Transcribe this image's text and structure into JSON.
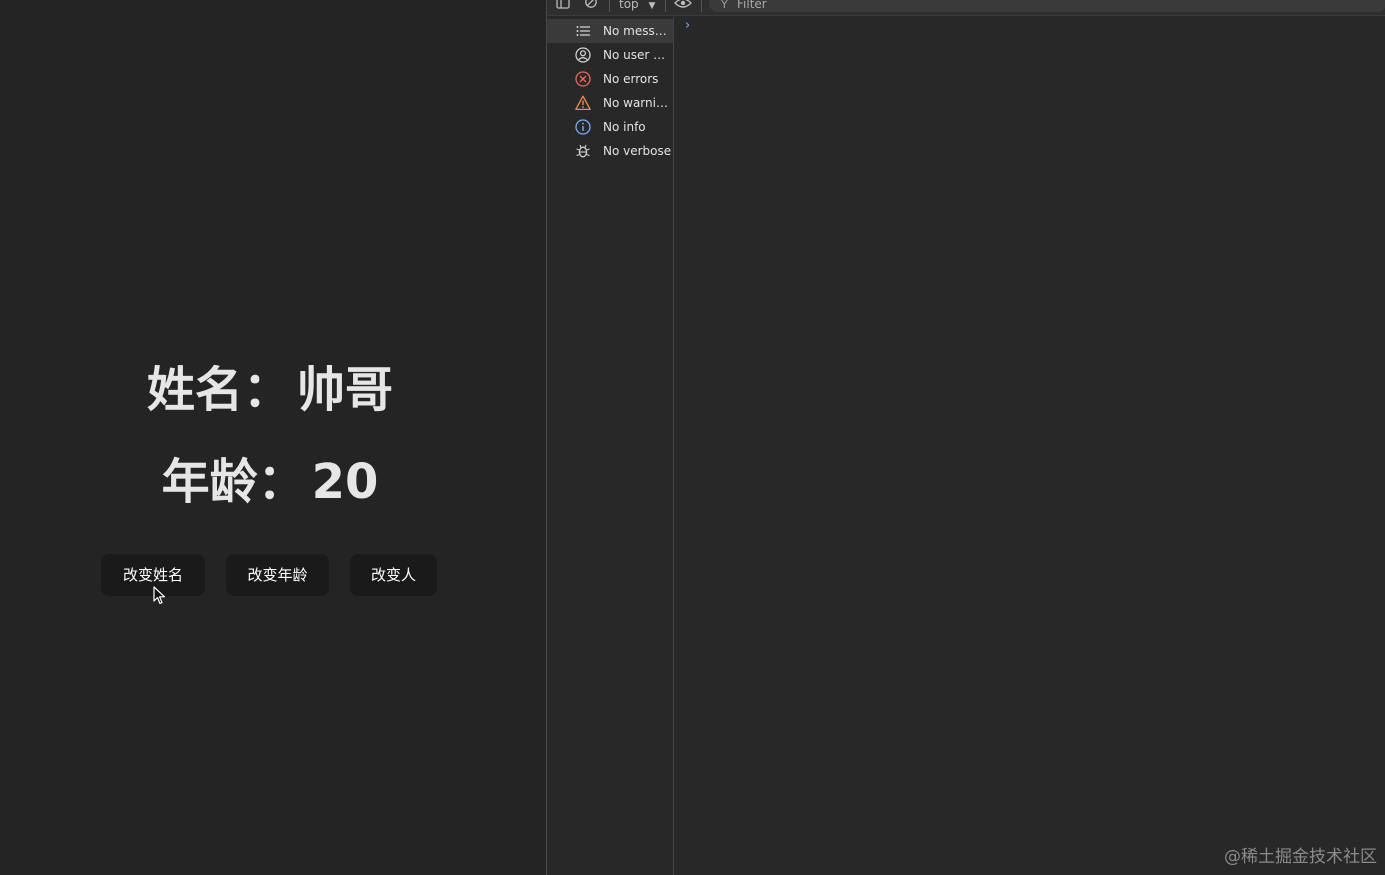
{
  "app": {
    "name_label": "姓名：",
    "name_value": "帅哥",
    "age_label": "年龄：",
    "age_value": "20",
    "buttons": {
      "change_name": "改变姓名",
      "change_age": "改变年龄",
      "change_person": "改变人"
    }
  },
  "devtools": {
    "toolbar": {
      "context": "top",
      "filter_placeholder": "Filter"
    },
    "sidebar": {
      "items": [
        {
          "label": "No messa...",
          "icon": "list-icon"
        },
        {
          "label": "No user m...",
          "icon": "user-icon"
        },
        {
          "label": "No errors",
          "icon": "error-icon"
        },
        {
          "label": "No warnin...",
          "icon": "warning-icon"
        },
        {
          "label": "No info",
          "icon": "info-icon"
        },
        {
          "label": "No verbose",
          "icon": "bug-icon"
        }
      ]
    },
    "prompt_glyph": "›"
  },
  "watermark": "@稀土掘金技术社区",
  "colors": {
    "background": "#242424",
    "button_bg": "#1a1a1a",
    "error": "#e46962",
    "warning": "#f28b54",
    "info": "#7cacf8",
    "prompt": "#7cacf8"
  }
}
